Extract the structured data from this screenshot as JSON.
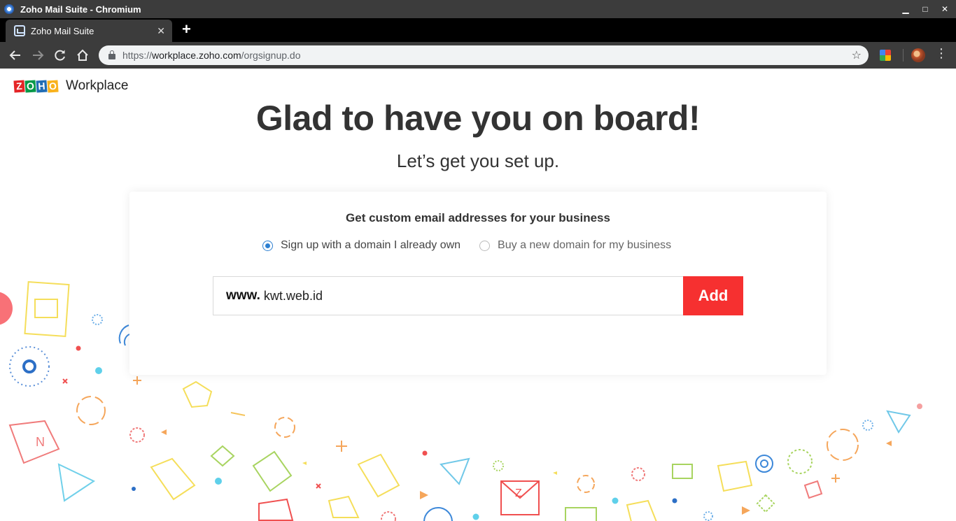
{
  "window": {
    "title": "Zoho Mail Suite - Chromium"
  },
  "tab": {
    "title": "Zoho Mail Suite"
  },
  "address_bar": {
    "scheme": "https://",
    "host": "workplace.zoho.com",
    "path": "/orgsignup.do"
  },
  "brand": {
    "logo_letters": [
      "Z",
      "O",
      "H",
      "O"
    ],
    "logo_colors": [
      "#e42527",
      "#089949",
      "#226db4",
      "#f9b21d"
    ],
    "product": "Workplace"
  },
  "page": {
    "headline": "Glad to have you on board!",
    "subheadline": "Let’s get you set up."
  },
  "card": {
    "title": "Get custom email addresses for your business",
    "options": [
      {
        "label": "Sign up with a domain I already own",
        "selected": true
      },
      {
        "label": "Buy a new domain for my business",
        "selected": false
      }
    ],
    "domain_prefix": "www.",
    "domain_value": "kwt.web.id",
    "add_label": "Add"
  },
  "colors": {
    "accent_red": "#f63030",
    "radio_blue": "#2c7fd1",
    "heading": "#333333"
  }
}
